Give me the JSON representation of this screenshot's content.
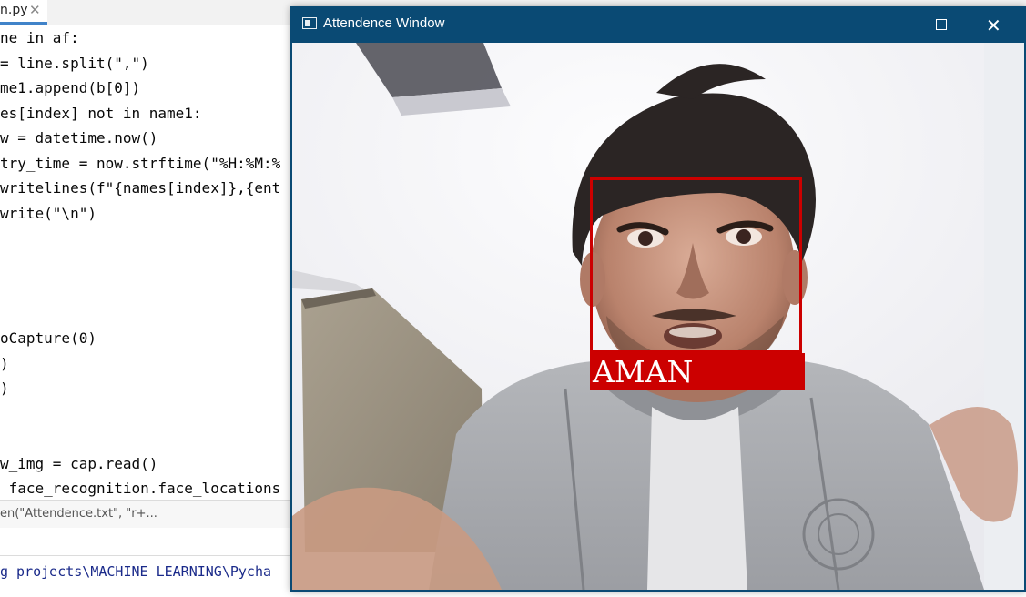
{
  "ide": {
    "tab": {
      "label": "n.py",
      "close": "✕"
    },
    "code_lines": [
      "ne in af:",
      "= line.split(\",\")",
      "me1.append(b[0])",
      "es[index] not in name1:",
      "w = datetime.now()",
      "try_time = now.strftime(\"%H:%M:%",
      "writelines(f\"{names[index]},{ent",
      "write(\"\\n\")",
      "",
      "",
      "",
      "oCapture(0)",
      ")",
      ")",
      "",
      "",
      "w_img = cap.read()",
      " face_recognition.face_locations"
    ],
    "breadcrumb": "en(\"Attendence.txt\", \"r+...",
    "console": "g projects\\MACHINE LEARNING\\Pycha"
  },
  "window": {
    "title": "Attendence Window",
    "controls": {
      "minimize": "",
      "maximize": "",
      "close": "✕"
    },
    "detection": {
      "name": "AMAN"
    }
  },
  "colors": {
    "titlebar": "#0a4a74",
    "detection_box": "#cc0000",
    "keyword": "#0033b3",
    "string": "#067d17",
    "number": "#1750eb"
  }
}
